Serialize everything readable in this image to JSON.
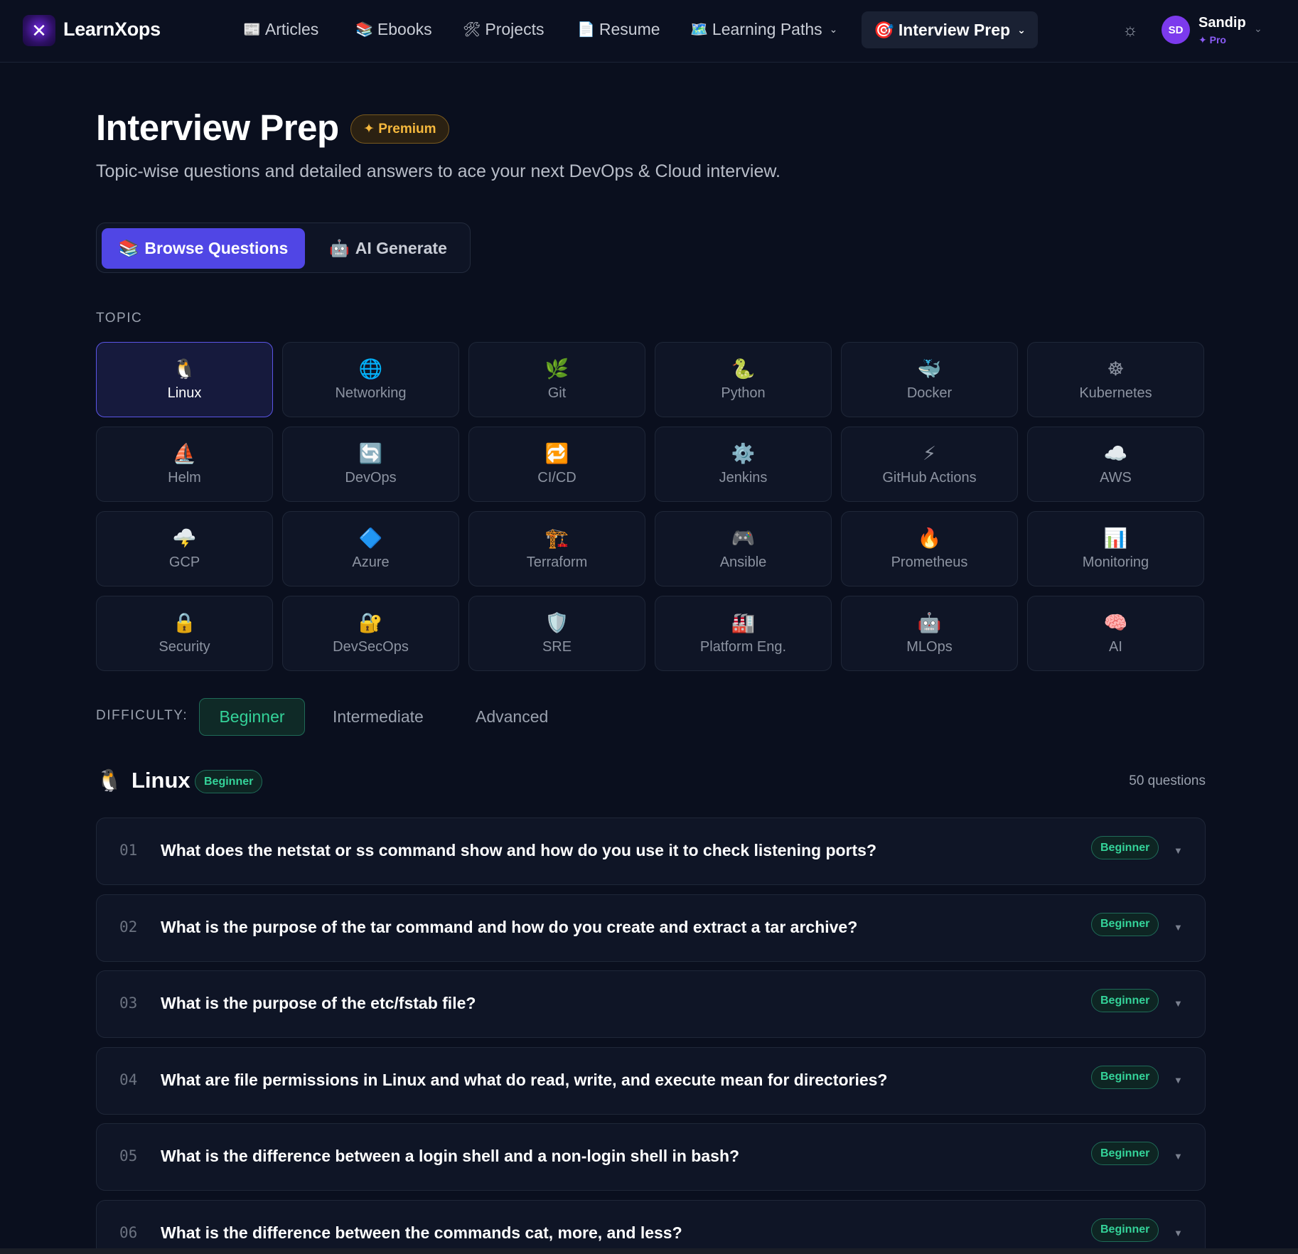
{
  "brand": {
    "name": "LearnXops",
    "logo_glyph": "✕"
  },
  "nav": {
    "items": [
      {
        "icon": "📰",
        "label": "Articles"
      },
      {
        "icon": "📚",
        "label": "Ebooks"
      },
      {
        "icon": "🛠",
        "label": "Projects"
      },
      {
        "icon": "📄",
        "label": "Resume"
      },
      {
        "icon": "🗺️",
        "label": "Learning Paths"
      }
    ],
    "active": {
      "icon": "🎯",
      "label": "Interview Prep"
    }
  },
  "user": {
    "initials": "SD",
    "name": "Sandip",
    "tier": "✦ Pro"
  },
  "header": {
    "title": "Interview Prep",
    "badge": "✦ Premium",
    "subtitle": "Topic-wise questions and detailed answers to ace your next DevOps & Cloud interview."
  },
  "mode_tabs": [
    {
      "icon": "📚",
      "label": "Browse Questions"
    },
    {
      "icon": "🤖",
      "label": "AI Generate"
    }
  ],
  "topic_label": "TOPIC",
  "topics": [
    {
      "icon": "🐧",
      "label": "Linux"
    },
    {
      "icon": "🌐",
      "label": "Networking"
    },
    {
      "icon": "🌿",
      "label": "Git"
    },
    {
      "icon": "🐍",
      "label": "Python"
    },
    {
      "icon": "🐳",
      "label": "Docker"
    },
    {
      "icon": "☸",
      "label": "Kubernetes"
    },
    {
      "icon": "⛵",
      "label": "Helm"
    },
    {
      "icon": "🔄",
      "label": "DevOps"
    },
    {
      "icon": "🔁",
      "label": "CI/CD"
    },
    {
      "icon": "⚙️",
      "label": "Jenkins"
    },
    {
      "icon": "⚡",
      "label": "GitHub Actions"
    },
    {
      "icon": "☁️",
      "label": "AWS"
    },
    {
      "icon": "🌩️",
      "label": "GCP"
    },
    {
      "icon": "🔷",
      "label": "Azure"
    },
    {
      "icon": "🏗️",
      "label": "Terraform"
    },
    {
      "icon": "🎮",
      "label": "Ansible"
    },
    {
      "icon": "🔥",
      "label": "Prometheus"
    },
    {
      "icon": "📊",
      "label": "Monitoring"
    },
    {
      "icon": "🔒",
      "label": "Security"
    },
    {
      "icon": "🔐",
      "label": "DevSecOps"
    },
    {
      "icon": "🛡️",
      "label": "SRE"
    },
    {
      "icon": "🏭",
      "label": "Platform Eng."
    },
    {
      "icon": "🤖",
      "label": "MLOps"
    },
    {
      "icon": "🧠",
      "label": "AI"
    }
  ],
  "difficulty": {
    "label": "DIFFICULTY:",
    "options": [
      "Beginner",
      "Intermediate",
      "Advanced"
    ]
  },
  "list": {
    "icon": "🐧",
    "title": "Linux",
    "level": "Beginner",
    "count": "50 questions"
  },
  "questions": [
    {
      "num": "01",
      "text": "What does the netstat or ss command show and how do you use it to check listening ports?",
      "level": "Beginner"
    },
    {
      "num": "02",
      "text": "What is the purpose of the tar command and how do you create and extract a tar archive?",
      "level": "Beginner"
    },
    {
      "num": "03",
      "text": "What is the purpose of the etc/fstab file?",
      "level": "Beginner"
    },
    {
      "num": "04",
      "text": "What are file permissions in Linux and what do read, write, and execute mean for directories?",
      "level": "Beginner"
    },
    {
      "num": "05",
      "text": "What is the difference between a login shell and a non-login shell in bash?",
      "level": "Beginner"
    },
    {
      "num": "06",
      "text": "What is the difference between the commands cat, more, and less?",
      "level": "Beginner"
    }
  ],
  "colors": {
    "background": "#0a0f1e",
    "accent": "#5046e5",
    "premium": "#f5b83d",
    "success": "#34d399"
  }
}
